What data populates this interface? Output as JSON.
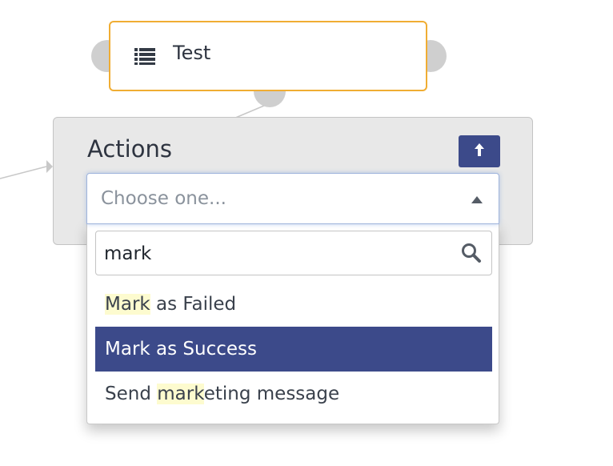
{
  "node": {
    "title": "Test",
    "icon": "list-icon",
    "border_color": "#f0ad33"
  },
  "panel": {
    "title": "Actions",
    "upload_icon": "upload-arrow-icon",
    "button_color": "#3c4a8a"
  },
  "select": {
    "placeholder": "Choose one...",
    "icon": "caret-up-icon"
  },
  "search": {
    "value": "mark",
    "icon": "search-icon"
  },
  "options": [
    {
      "match": "Mark",
      "rest": " as Failed",
      "selected": false
    },
    {
      "label": "Mark as Success",
      "selected": true
    },
    {
      "prefix": "Send ",
      "match": "mark",
      "rest": "eting message",
      "selected": false
    }
  ],
  "colors": {
    "highlight": "#fdfbcf",
    "selected_bg": "#3c4a8a"
  }
}
